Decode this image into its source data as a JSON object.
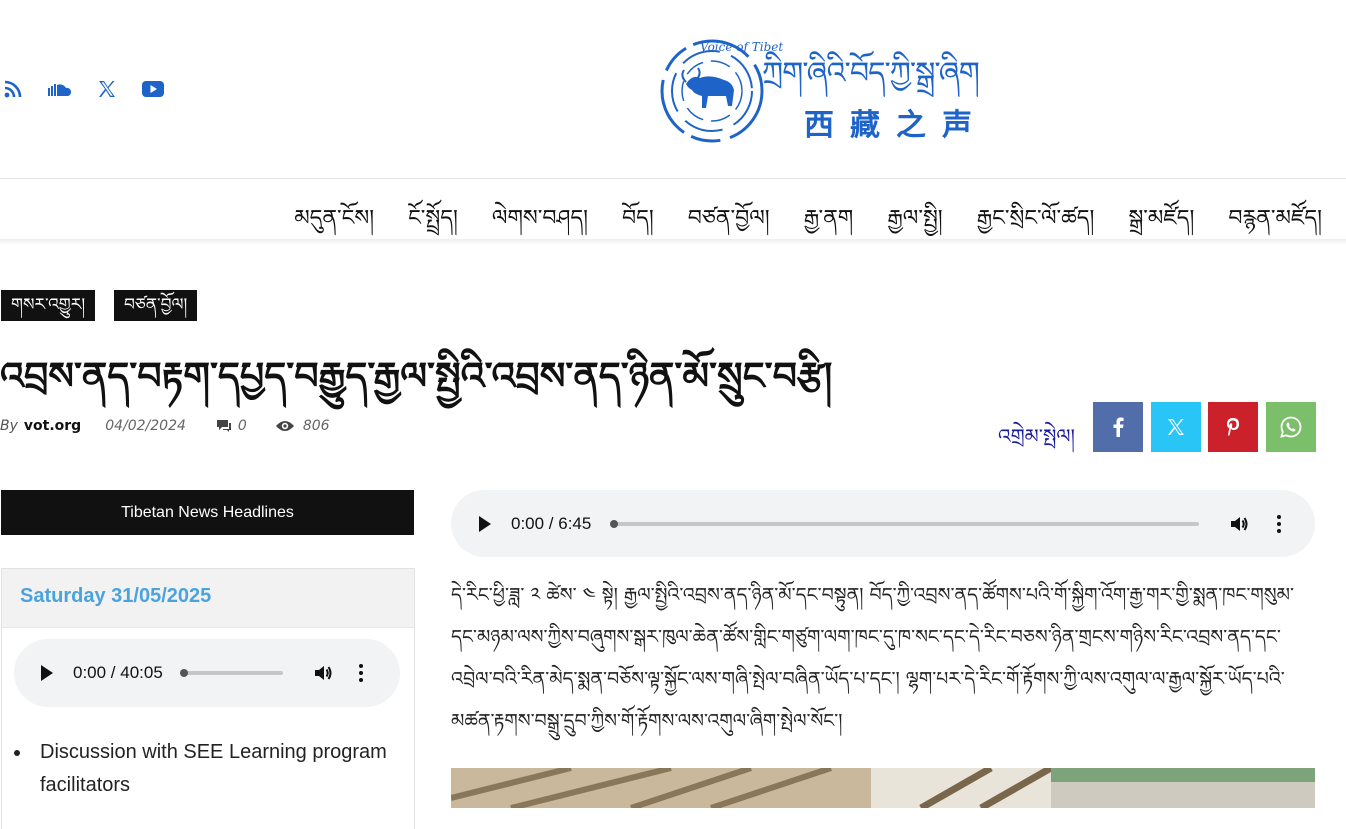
{
  "header": {
    "social_icons": [
      "rss-icon",
      "soundcloud-icon",
      "x-icon",
      "youtube-icon"
    ],
    "logo": {
      "tibetan_text": "ཀྲིག་ཞིའི་བོད་ཀྱི་སྒྲ་ཞིག",
      "chinese_text": "西藏之声",
      "ring_text": "Voice of Tibet",
      "brand_color": "#1e64c8"
    }
  },
  "nav": {
    "items": [
      "མདུན་ངོས།",
      "ངོ་སྤྲོད།",
      "ལེགས་བཤད།",
      "བོད།",
      "བཙན་བྱོལ།",
      "རྒྱ་ནག",
      "རྒྱལ་སྤྱི།",
      "རྒྱང་སྲིང་ལོ་ཚད།",
      "སྒྲ་མཛོད།",
      "བརྙན་མཛོད།"
    ]
  },
  "article": {
    "tags": [
      "གསར་འགྱུར།",
      "བཙན་བྱོལ།"
    ],
    "title": "འབྲས་ནད་བརྟག་དཔྱད་བརྒྱུད་རྒྱལ་སྤྱིའི་འབྲས་ནད་ཉིན་མོ་སྲུང་བརྩི།",
    "meta": {
      "by": "By",
      "author": "vot.org",
      "date": "04/02/2024",
      "comments": "0",
      "views": "806"
    },
    "share_label": "འགྲེམ་སྤེལ།",
    "share_buttons": [
      {
        "name": "facebook",
        "color": "#516eab"
      },
      {
        "name": "x",
        "color": "#29c5f6"
      },
      {
        "name": "pinterest",
        "color": "#ca212a"
      },
      {
        "name": "whatsapp",
        "color": "#7bbf6a"
      }
    ],
    "audio": {
      "time": "0:00 / 6:45",
      "progress": 0
    },
    "body": "དེ་རིང་ཕྱི་ཟླ་ ༢ ཚེས་ ༤ སྟེ། རྒྱལ་སྤྱིའི་འབྲས་ནད་ཉིན་མོ་དང་བསྟུན། བོད་ཀྱི་འབྲས་ནད་ཚོགས་པའི་གོ་སྐྱིག་འོག་རྒྱ་གར་གྱི་སྨན་ཁང་གསུམ་དང་མཉམ་ལས་ཀྱིས་བཞུགས་སྒར་ཁུལ་ཆེན་ཚོས་གླིང་གཙུག་ལག་ཁང་དུ་ཁ་སང་དང་དེ་རིང་བཅས་ཉིན་གྲངས་གཉིས་རིང་འབྲས་ནད་དང་འབྲེལ་བའི་རིན་མེད་སྨན་བཅོས་ལྟ་སྐྱོང་ལས་གཞི་སྤེལ་བཞིན་ཡོད་པ་དང་། ལྷག་པར་དེ་རིང་གོ་རྟོགས་ཀྱི་ལས་འགུལ་ལ་རྒྱལ་སྐྱོར་ཡོད་པའི་མཚན་རྟགས་བསྒྲུ་དྲུབ་ཀྱིས་གོ་རྟོགས་ལས་འགུལ་ཞིག་སྤེལ་སོང་།"
  },
  "sidebar": {
    "heading": "Tibetan News Headlines",
    "date": "Saturday 31/05/2025",
    "audio": {
      "time": "0:00 / 40:05",
      "progress": 0
    },
    "list": [
      "Discussion with SEE Learning program facilitators"
    ]
  }
}
